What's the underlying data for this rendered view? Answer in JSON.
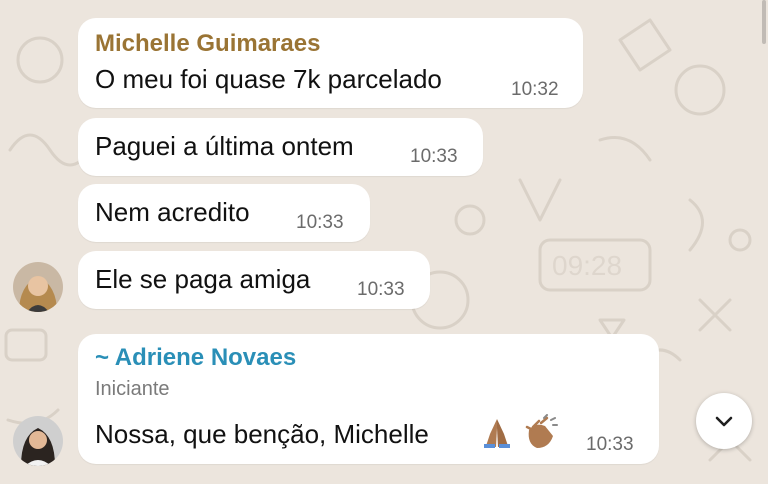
{
  "chat": {
    "messages": [
      {
        "sender": "Michelle Guimaraes",
        "text": "O meu foi quase 7k parcelado",
        "time": "10:32"
      },
      {
        "text": "Paguei a última ontem",
        "time": "10:33"
      },
      {
        "text": "Nem acredito",
        "time": "10:33"
      },
      {
        "text": "Ele se paga amiga",
        "time": "10:33"
      },
      {
        "sender": "~ Adriene Novaes",
        "subtitle": "Iniciante",
        "text": "Nossa, que benção, Michelle",
        "time": "10:33"
      }
    ]
  },
  "colors": {
    "wallpaper": "#ece5dd",
    "bubble": "#ffffff",
    "sender_michelle": "#9a7434",
    "sender_adriene": "#2a8fb7"
  },
  "icons": {
    "emojis": [
      "folded-hands-emoji",
      "clapping-hands-emoji"
    ],
    "scroll": "chevron-down-icon"
  }
}
